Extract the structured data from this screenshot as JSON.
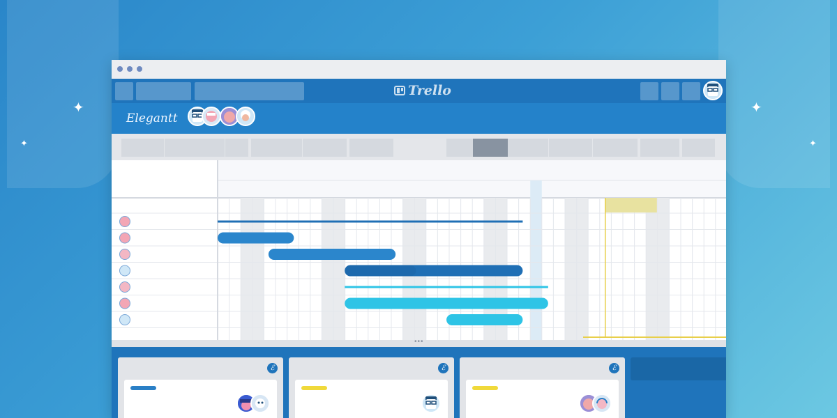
{
  "app": {
    "name": "Trello",
    "board_title": "Elegantt"
  },
  "titlebar": {
    "dots": 3
  },
  "colors": {
    "page_bg": "#3c9fd6",
    "topbar": "#1f74bb",
    "boardbar": "#2482ca",
    "bar_dark": "#1f6fb5",
    "bar_mid": "#2b86cc",
    "bar_cyan": "#2ec4e6",
    "today_highlight": "#e8e2a0",
    "label_blue": "#2a7fc6",
    "label_yellow": "#f0d93a"
  },
  "board_members": [
    "glasses-man-avatar",
    "pink-woman-avatar",
    "bald-man-avatar",
    "white-hair-man-avatar"
  ],
  "top_right_avatar": "glasses-man-avatar",
  "gantt": {
    "rows": [
      {
        "avatar": "pink-woman-avatar",
        "bar_style": "thin",
        "color": "#1f6fb5",
        "start": 0.0,
        "end": 0.6
      },
      {
        "avatar": "pink-woman-avatar",
        "bar_style": "thick",
        "color": "#2b86cc",
        "start": 0.0,
        "end": 0.15
      },
      {
        "avatar": "headset-person-avatar",
        "bar_style": "thick",
        "color": "#2b86cc",
        "start": 0.1,
        "end": 0.35
      },
      {
        "avatar": "glasses-man-avatar",
        "bar_style": "thick",
        "color": "#1f6fb5",
        "progress": 0.4,
        "start": 0.25,
        "end": 0.6
      },
      {
        "avatar": "headset-person-avatar",
        "bar_style": "thin",
        "color": "#2ec4e6",
        "start": 0.25,
        "end": 0.65
      },
      {
        "avatar": "pink-woman-avatar",
        "bar_style": "thick",
        "color": "#2ec4e6",
        "start": 0.25,
        "end": 0.65
      },
      {
        "avatar": "glasses-man-avatar",
        "bar_style": "thick",
        "color": "#2ec4e6",
        "start": 0.45,
        "end": 0.6
      }
    ]
  },
  "lists": [
    {
      "icon": "elegantt-icon",
      "card_label_color": "#2a7fc6",
      "card_members": [
        "viking-avatar",
        "robot-avatar"
      ]
    },
    {
      "icon": "elegantt-icon",
      "card_label_color": "#f0d93a",
      "card_members": [
        "glasses-man-avatar"
      ]
    },
    {
      "icon": "elegantt-icon",
      "card_label_color": "#f0d93a",
      "card_members": [
        "bald-man-avatar",
        "headset-person-avatar"
      ]
    }
  ]
}
